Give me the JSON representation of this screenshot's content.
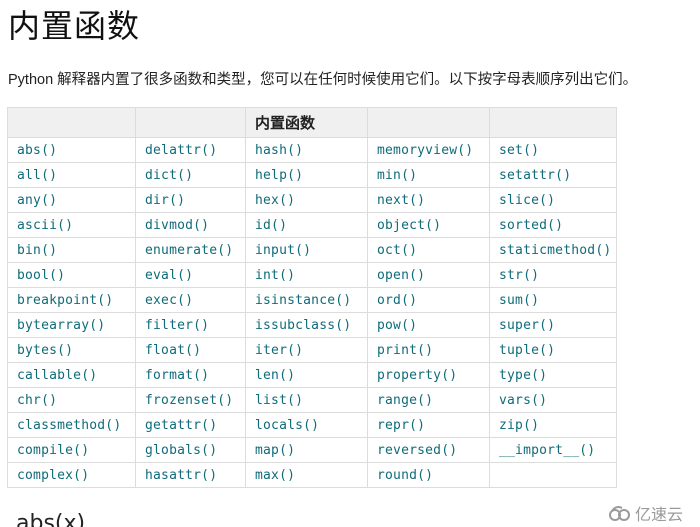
{
  "title": "内置函数",
  "intro": "Python 解释器内置了很多函数和类型，您可以在任何时候使用它们。以下按字母表顺序列出它们。",
  "table": {
    "headers": [
      "",
      "",
      "内置函数",
      "",
      ""
    ],
    "rows": [
      [
        "abs()",
        "delattr()",
        "hash()",
        "memoryview()",
        "set()"
      ],
      [
        "all()",
        "dict()",
        "help()",
        "min()",
        "setattr()"
      ],
      [
        "any()",
        "dir()",
        "hex()",
        "next()",
        "slice()"
      ],
      [
        "ascii()",
        "divmod()",
        "id()",
        "object()",
        "sorted()"
      ],
      [
        "bin()",
        "enumerate()",
        "input()",
        "oct()",
        "staticmethod()"
      ],
      [
        "bool()",
        "eval()",
        "int()",
        "open()",
        "str()"
      ],
      [
        "breakpoint()",
        "exec()",
        "isinstance()",
        "ord()",
        "sum()"
      ],
      [
        "bytearray()",
        "filter()",
        "issubclass()",
        "pow()",
        "super()"
      ],
      [
        "bytes()",
        "float()",
        "iter()",
        "print()",
        "tuple()"
      ],
      [
        "callable()",
        "format()",
        "len()",
        "property()",
        "type()"
      ],
      [
        "chr()",
        "frozenset()",
        "list()",
        "range()",
        "vars()"
      ],
      [
        "classmethod()",
        "getattr()",
        "locals()",
        "repr()",
        "zip()"
      ],
      [
        "compile()",
        "globals()",
        "map()",
        "reversed()",
        "__import__()"
      ],
      [
        "complex()",
        "hasattr()",
        "max()",
        "round()",
        ""
      ]
    ]
  },
  "next_heading": "abs(x)",
  "watermark": {
    "icon": "cloud-logo-icon",
    "text": "亿速云"
  }
}
